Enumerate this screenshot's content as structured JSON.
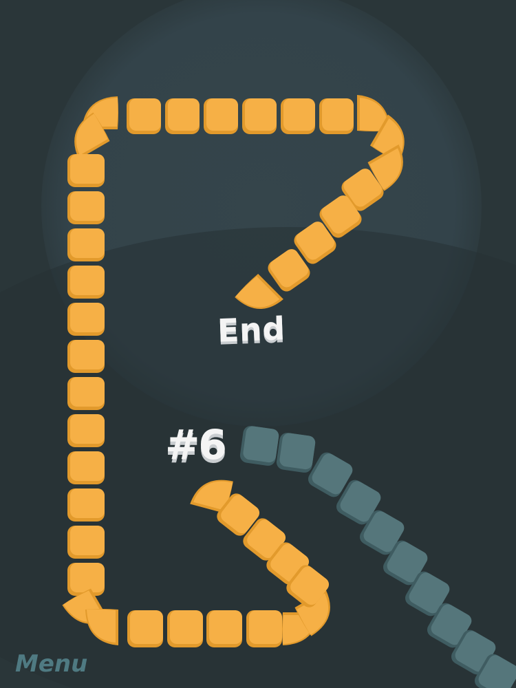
{
  "game": {
    "end_label": "End",
    "level_label": "#6",
    "menu_label": "Menu"
  },
  "colors": {
    "background": "#2a3639",
    "background_glow": "#34444a",
    "path_segment": "#f6b046",
    "path_segment_shadow": "#e29a2c",
    "snake_segment": "#55767b",
    "snake_segment_shadow": "#3f5c61",
    "label_text": "#f4f4f4",
    "menu_text": "#4f7a82"
  },
  "icons": {
    "path_segment": "rounded-square-tile",
    "snake_segment": "rounded-square-tile"
  }
}
